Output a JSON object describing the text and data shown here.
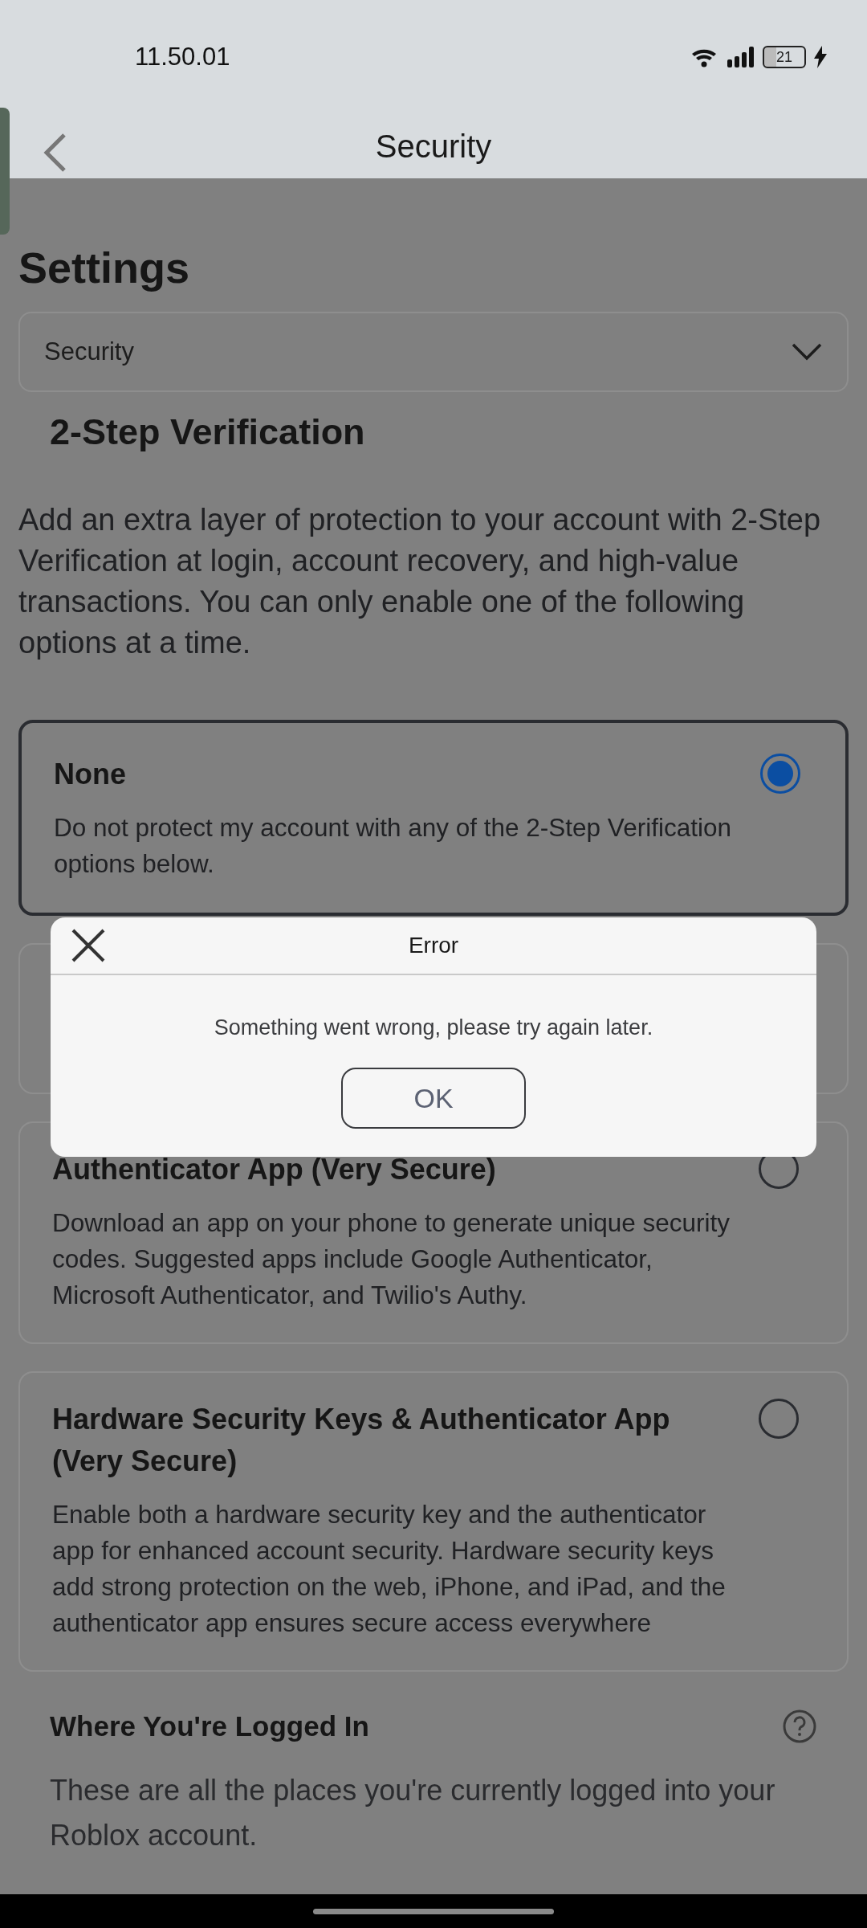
{
  "status_bar": {
    "time": "11.50.01",
    "battery": "21"
  },
  "header": {
    "title": "Security"
  },
  "page": {
    "title": "Settings",
    "dropdown": {
      "value": "Security"
    },
    "section_title": "2-Step Verification",
    "description": "Add an extra layer of protection to your account with 2-Step Verification at login, account recovery, and high-value transactions. You can only enable one of the following options at a time.",
    "options": [
      {
        "kind": "option",
        "title": "None",
        "description": "Do not protect my account with any of the 2-Step Verification options below.",
        "selected": true
      },
      {
        "kind": "covered"
      },
      {
        "kind": "option",
        "title": "Authenticator App (Very Secure)",
        "description": "Download an app on your phone to generate unique security codes. Suggested apps include Google Authenticator, Microsoft Authenticator, and Twilio's Authy.",
        "selected": false
      },
      {
        "kind": "option",
        "title": "Hardware Security Keys & Authenticator App (Very Secure)",
        "description": "Enable both a hardware security key and the authenticator app for enhanced account security. Hardware security keys add strong protection on the web, iPhone, and iPad, and the authenticator app ensures secure access everywhere",
        "selected": false
      }
    ],
    "logged_in": {
      "title": "Where You're Logged In",
      "description": "These are all the places you're currently logged into your Roblox account."
    }
  },
  "dialog": {
    "title": "Error",
    "message": "Something went wrong, please try again later.",
    "button": "OK"
  }
}
